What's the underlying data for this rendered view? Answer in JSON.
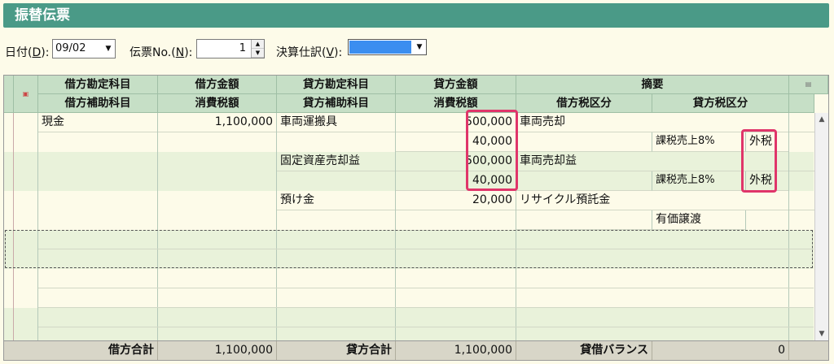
{
  "title": "振替伝票",
  "form": {
    "date_label_pre": "日付(",
    "date_key": "D",
    "date_label_post": "):",
    "date_value": "09/02",
    "voucher_label_pre": "伝票No.(",
    "voucher_key": "N",
    "voucher_label_post": "):",
    "voucher_value": "1",
    "closing_label_pre": "決算仕訳(",
    "closing_key": "V",
    "closing_label_post": "):"
  },
  "table": {
    "headers_row1": [
      "借方勘定科目",
      "借方金額",
      "貸方勘定科目",
      "貸方金額",
      "摘要"
    ],
    "headers_row2": [
      "借方補助科目",
      "消費税額",
      "貸方補助科目",
      "消費税額",
      "借方税区分",
      "貸方税区分"
    ],
    "rows": [
      {
        "debit_account": "現金",
        "debit_amount": "1,100,000",
        "credit_account": "車両運搬具",
        "credit_amount": "500,000",
        "summary": "車両売却"
      },
      {
        "credit_tax": "40,000",
        "credit_tax_class": "課税売上8%",
        "credit_tax_type": "外税"
      },
      {
        "credit_account": "固定資産売却益",
        "credit_amount": "500,000",
        "summary": "車両売却益"
      },
      {
        "credit_tax": "40,000",
        "credit_tax_class": "課税売上8%",
        "credit_tax_type": "外税"
      },
      {
        "credit_account": "預け金",
        "credit_amount": "20,000",
        "summary": "リサイクル預託金"
      },
      {
        "credit_tax_class": "有価譲渡"
      }
    ]
  },
  "footer": {
    "debit_total_label": "借方合計",
    "debit_total": "1,100,000",
    "credit_total_label": "貸方合計",
    "credit_total": "1,100,000",
    "balance_label": "貸借バランス",
    "balance": "0"
  },
  "colors": {
    "title_bar": "#4a9a87",
    "header_bg": "#c6dfc6",
    "highlight": "#e0356a",
    "closing_swatch": "#3b8ef0"
  },
  "icons": {
    "grid_corner": "row-marker-icon",
    "grid_settings": "column-settings-icon"
  }
}
